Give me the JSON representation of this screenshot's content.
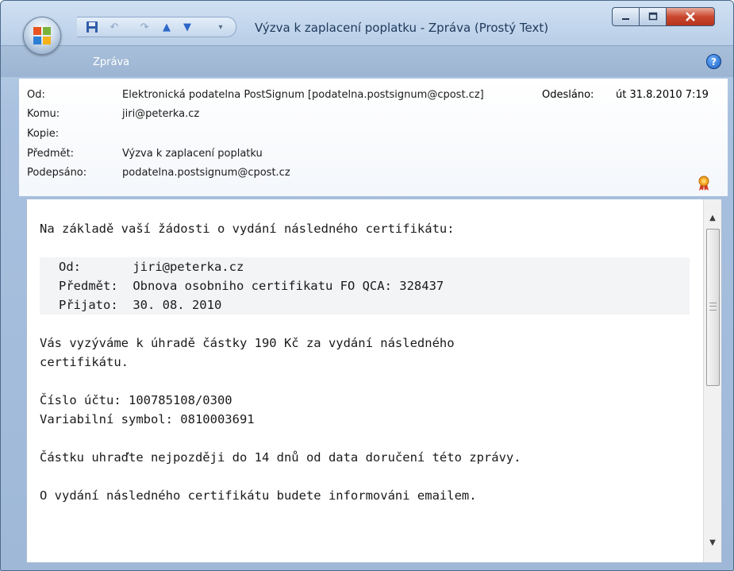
{
  "window": {
    "title": "Výzva k zaplacení poplatku - Zpráva (Prostý Text)"
  },
  "ribbon": {
    "tab_label": "Zpráva",
    "help": "?"
  },
  "header": {
    "from_label": "Od:",
    "from_value": "Elektronická podatelna PostSignum [podatelna.postsignum@cpost.cz]",
    "sent_label": "Odesláno:",
    "sent_value": "út 31.8.2010 7:19",
    "to_label": "Komu:",
    "to_value": "jiri@peterka.cz",
    "cc_label": "Kopie:",
    "cc_value": "",
    "subject_label": "Předmět:",
    "subject_value": "Výzva k zaplacení poplatku",
    "signed_label": "Podepsáno:",
    "signed_value": "podatelna.postsignum@cpost.cz"
  },
  "body": {
    "intro": "Na základě vaší žádosti o vydání následného certifikátu:",
    "quote": {
      "from": "Od:       jiri@peterka.cz",
      "subject": "Předmět:  Obnova osobniho certifikatu FO QCA: 328437",
      "received": "Přijato:  30. 08. 2010"
    },
    "para1_line1": "Vás vyzýváme k úhradě částky 190 Kč za vydání následného",
    "para1_line2": "certifikátu.",
    "account": "Číslo účtu: 100785108/0300",
    "variable_symbol": "Variabilní symbol: 0810003691",
    "deadline": "Částku uhraďte nejpozději do 14 dnů od data doručení této zprávy.",
    "notice": "O vydání následného certifikátu budete informováni emailem."
  },
  "colors": {
    "window_frame": "#b7cde6",
    "close_button": "#c9482f",
    "accent": "#1e395b"
  }
}
